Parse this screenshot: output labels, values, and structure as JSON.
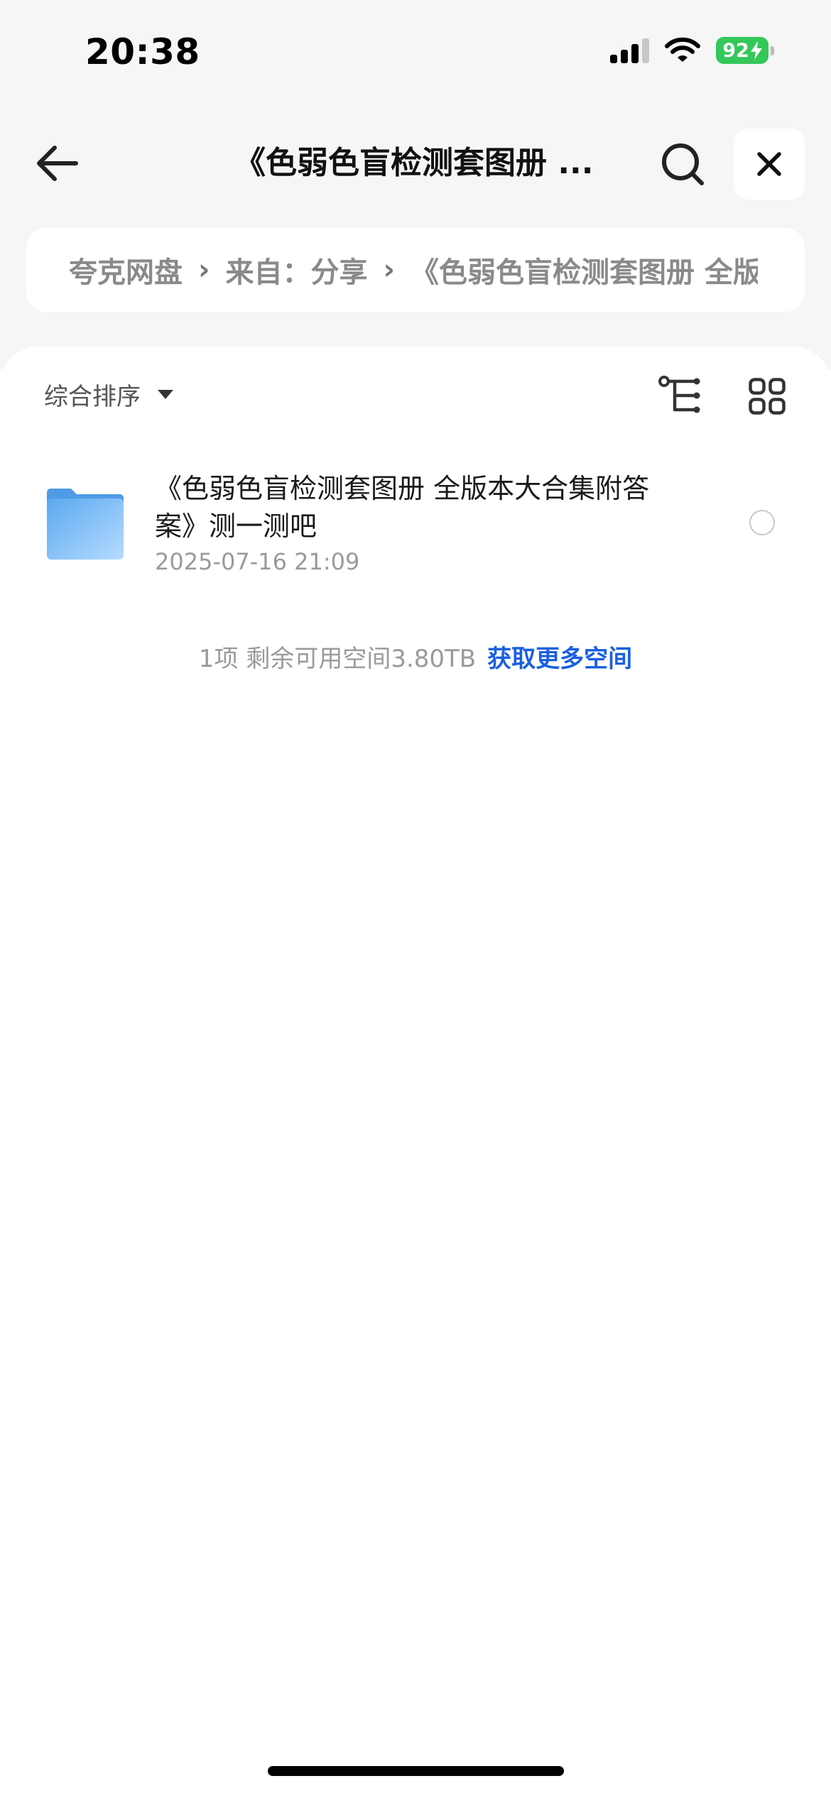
{
  "status_bar": {
    "time": "20:38",
    "battery_level": "92"
  },
  "nav": {
    "title": "《色弱色盲检测套图册 ...",
    "back_icon": "arrow-left-icon",
    "search_icon": "search-icon",
    "close_icon": "close-icon"
  },
  "breadcrumb": {
    "items": [
      "夸克网盘",
      "来自：分享",
      "《色弱色盲检测套图册 全版本大合集附答案》测一测吧"
    ],
    "separator": "›"
  },
  "toolbar": {
    "sort_label": "综合排序",
    "tree_icon": "tree-view-icon",
    "grid_icon": "grid-view-icon"
  },
  "files": [
    {
      "name": "《色弱色盲检测套图册 全版本大合集附答案》测一测吧",
      "date": "2025-07-16 21:09",
      "icon": "folder-icon"
    }
  ],
  "footer": {
    "summary": "1项 剩余可用空间3.80TB",
    "link": "获取更多空间"
  },
  "colors": {
    "accent": "#1a5fe0",
    "battery": "#34c759",
    "header_bg": "#f6f6f6"
  }
}
